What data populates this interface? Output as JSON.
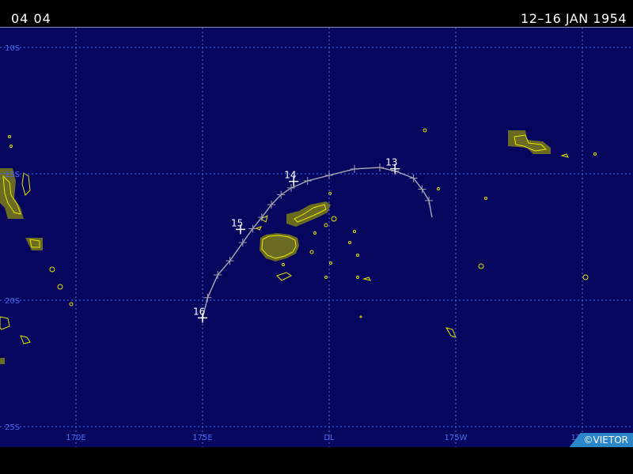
{
  "header": {
    "code": "04 04",
    "date_range": "12–16 JAN 1954"
  },
  "map": {
    "lat_labels": [
      {
        "label": "10S",
        "lat": -10
      },
      {
        "label": "15S",
        "lat": -15
      },
      {
        "label": "20S",
        "lat": -20
      },
      {
        "label": "25S",
        "lat": -25
      }
    ],
    "lon_labels": [
      {
        "label": "170E",
        "lon": 170
      },
      {
        "label": "175E",
        "lon": 175
      },
      {
        "label": "DL",
        "lon": 180
      },
      {
        "label": "175W",
        "lon": 185
      },
      {
        "label": "170W",
        "lon": 190
      }
    ],
    "colors": {
      "ocean": "#06065e",
      "grid": "#4a6cf0",
      "land_fill": "#6a6a22",
      "coastline": "#e6e600",
      "track": "#a0a0b0",
      "track_label": "#ffffff"
    },
    "track": {
      "points": [
        [
          -16.72,
          184.06
        ],
        [
          -16.06,
          183.94
        ],
        [
          -15.61,
          183.67
        ],
        [
          -15.17,
          183.33
        ],
        [
          -14.89,
          182.6
        ],
        [
          -14.75,
          182.0
        ],
        [
          -14.81,
          181.0
        ],
        [
          -15.06,
          180.0
        ],
        [
          -15.28,
          179.15
        ],
        [
          -15.56,
          178.5
        ],
        [
          -15.83,
          178.1
        ],
        [
          -16.22,
          177.72
        ],
        [
          -16.72,
          177.34
        ],
        [
          -17.17,
          176.98
        ],
        [
          -17.72,
          176.59
        ],
        [
          -18.44,
          176.08
        ],
        [
          -19.0,
          175.6
        ],
        [
          -19.9,
          175.2
        ],
        [
          -20.7,
          175.0
        ]
      ],
      "day_labels": [
        {
          "label": "13",
          "lat": -14.8,
          "lon": 182.6
        },
        {
          "label": "14",
          "lat": -15.3,
          "lon": 178.6
        },
        {
          "label": "15",
          "lat": -17.2,
          "lon": 176.5
        },
        {
          "label": "16",
          "lat": -20.7,
          "lon": 175.0
        }
      ]
    }
  },
  "credit": "©VIETOR"
}
